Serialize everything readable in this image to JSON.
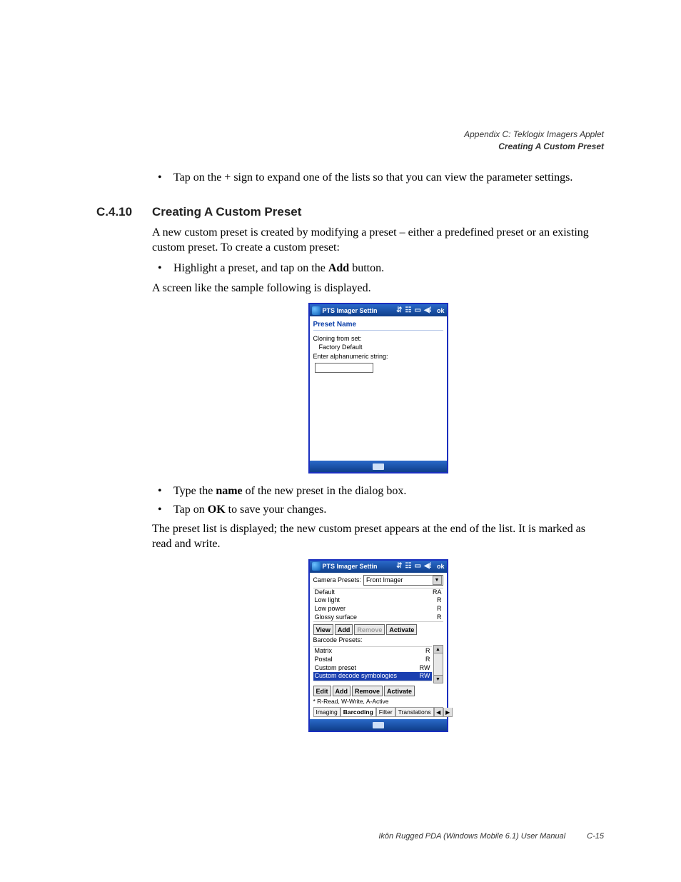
{
  "header": {
    "line1": "Appendix C: Teklogix Imagers Applet",
    "line2": "Creating A Custom Preset"
  },
  "intro_bullet": "Tap on the + sign to expand one of the lists so that you can view the parameter settings.",
  "section": {
    "number": "C.4.10",
    "title": "Creating A Custom Preset"
  },
  "para1": "A new custom preset is created by modifying a preset – either a predefined preset or an existing custom preset. To create a custom preset:",
  "bullet_highlight_pre": "Highlight a preset, and tap on the ",
  "bullet_highlight_bold": "Add",
  "bullet_highlight_post": " button.",
  "para2": "A screen like the sample following is displayed.",
  "screenshot1": {
    "title": "PTS Imager Settin",
    "ok": "ok",
    "heading": "Preset Name",
    "label_cloning": "Cloning from set:",
    "cloning_value": "Factory Default",
    "label_enter": "Enter alphanumeric string:"
  },
  "bullets2": {
    "type_pre": "Type the ",
    "type_bold": "name",
    "type_post": " of the new preset in the dialog box.",
    "ok_pre": "Tap on ",
    "ok_bold": "OK",
    "ok_post": " to save your changes."
  },
  "para3": "The preset list is displayed; the new custom preset appears at the end of the list. It is marked as read and write.",
  "screenshot2": {
    "title": "PTS Imager Settin",
    "ok": "ok",
    "camera_label": "Camera Presets:",
    "camera_value": "Front Imager",
    "camera_list": [
      {
        "name": "Default",
        "flag": "RA"
      },
      {
        "name": "Low light",
        "flag": "R"
      },
      {
        "name": "Low power",
        "flag": "R"
      },
      {
        "name": "Glossy surface",
        "flag": "R"
      }
    ],
    "buttons1": {
      "view": "View",
      "add": "Add",
      "remove": "Remove",
      "activate": "Activate"
    },
    "barcode_label": "Barcode Presets:",
    "barcode_list": [
      {
        "name": "Matrix",
        "flag": "R"
      },
      {
        "name": "Postal",
        "flag": "R"
      },
      {
        "name": "Custom preset",
        "flag": "RW"
      },
      {
        "name": "Custom decode symbologies",
        "flag": "RW",
        "highlight": true
      }
    ],
    "buttons2": {
      "edit": "Edit",
      "add": "Add",
      "remove": "Remove",
      "activate": "Activate"
    },
    "legend": "* R-Read, W-Write, A-Active",
    "tabs": {
      "imaging": "Imaging",
      "barcoding": "Barcoding",
      "filter": "Filter",
      "translations": "Translations"
    }
  },
  "footer": {
    "text": "Ikôn Rugged PDA (Windows Mobile 6.1) User Manual",
    "page": "C-15"
  }
}
